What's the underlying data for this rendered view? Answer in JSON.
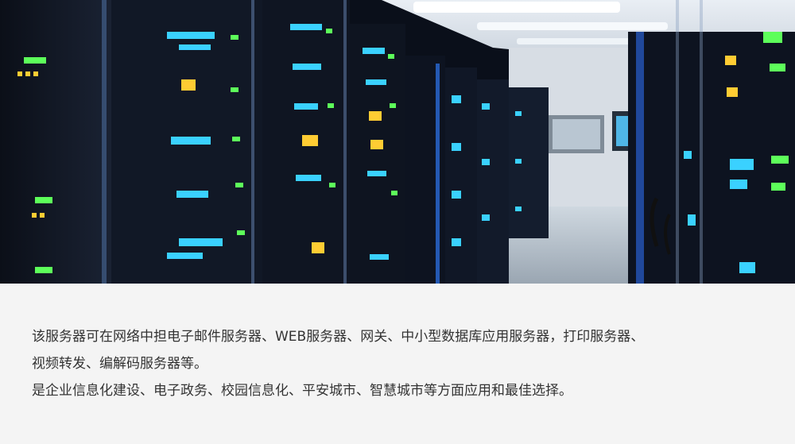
{
  "hero": {
    "image_label": "server-room-photo"
  },
  "description": {
    "line1": "该服务器可在网络中担电子邮件服务器、WEB服务器、网关、中小型数据库应用服务器，打印服务器、",
    "line2": "视频转发、编解码服务器等。",
    "line3": "是企业信息化建设、电子政务、校园信息化、平安城市、智慧城市等方面应用和最佳选择。"
  },
  "colors": {
    "background": "#f4f4f4",
    "text": "#333333",
    "led_blue": "#3ad1ff",
    "led_green": "#5dff5a",
    "led_amber": "#ffcc33"
  }
}
